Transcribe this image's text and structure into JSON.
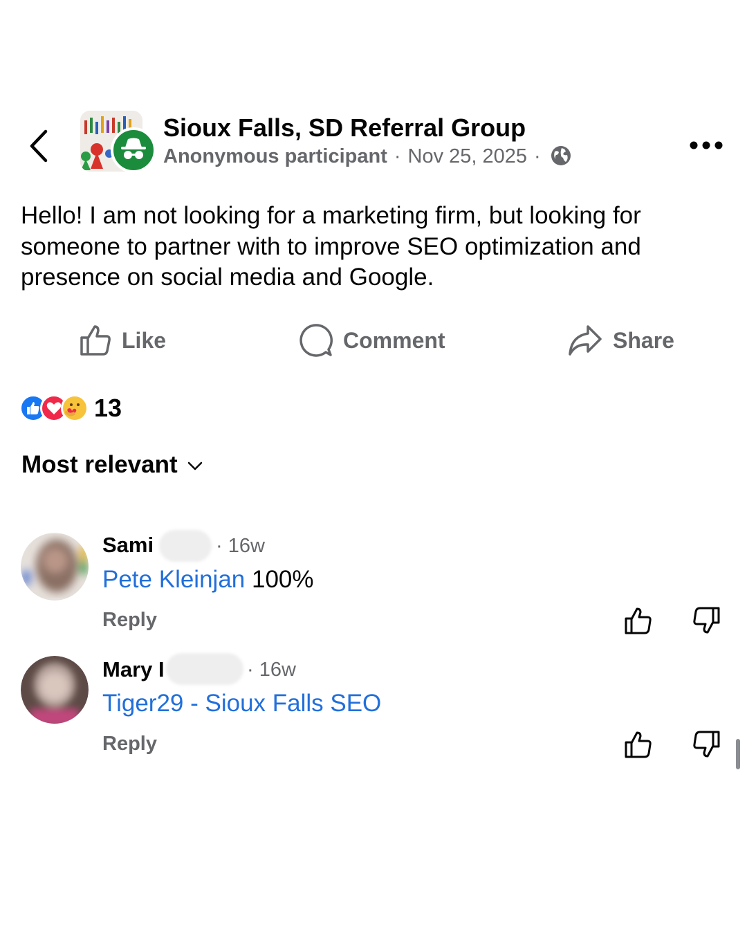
{
  "header": {
    "group_name": "Sioux Falls, SD Referral Group",
    "author": "Anonymous participant",
    "separator": "·",
    "date": "Nov 25, 2025",
    "audience_icon": "globe-icon",
    "anon_icon": "incognito-icon"
  },
  "post": {
    "text": "Hello! I am not looking for a marketing firm, but looking for someone to partner with to improve SEO optimization and presence on social media and Google."
  },
  "actions": {
    "like": "Like",
    "comment": "Comment",
    "share": "Share"
  },
  "reactions": {
    "count": "13",
    "types": [
      "like",
      "love",
      "care"
    ]
  },
  "sort": {
    "label": "Most relevant"
  },
  "comments": [
    {
      "name": "Sami",
      "time": "· 16w",
      "mention": "Pete Kleinjan",
      "text": " 100%",
      "reply": "Reply"
    },
    {
      "name": "Mary I",
      "time": "· 16w",
      "mention": "Tiger29 - Sioux Falls SEO",
      "text": "",
      "reply": "Reply"
    }
  ],
  "colors": {
    "link": "#216fdb",
    "secondary_text": "#65676b",
    "anon_badge": "#1a8c3c"
  }
}
